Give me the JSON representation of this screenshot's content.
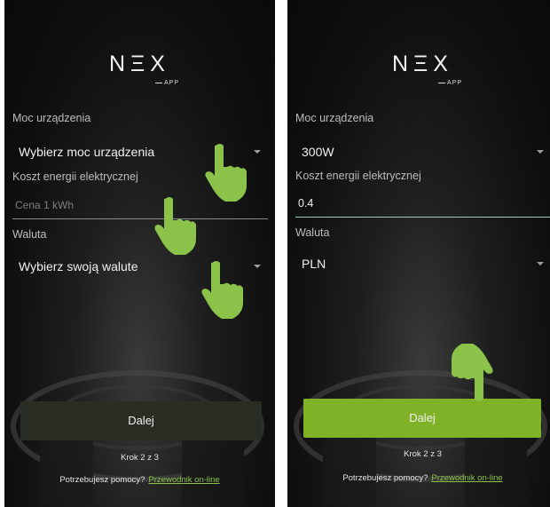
{
  "logo": {
    "main": "NΞX",
    "sub": "APP"
  },
  "left": {
    "device_power_label": "Moc urządzenia",
    "device_power_value": "Wybierz moc urządzenia",
    "energy_cost_label": "Koszt energii elektrycznej",
    "energy_cost_placeholder": "Cena 1 kWh",
    "currency_label": "Waluta",
    "currency_value": "Wybierz swoją walute",
    "next_button": "Dalej",
    "step": "Krok 2 z 3",
    "help_text": "Potrzebujesz pomocy?",
    "help_link": "Przewodnik on-line"
  },
  "right": {
    "device_power_label": "Moc urządzenia",
    "device_power_value": "300W",
    "energy_cost_label": "Koszt energii elektrycznej",
    "energy_cost_value": "0.4",
    "currency_label": "Waluta",
    "currency_value": "PLN",
    "next_button": "Dalej",
    "step": "Krok 2 z 3",
    "help_text": "Potrzebujesz pomocy?",
    "help_link": "Przewodnik on-line"
  },
  "colors": {
    "accent": "#7fb226",
    "hand": "#8bc34a",
    "active_underline": "#9acdc9"
  },
  "icons": [
    "dropdown-caret-icon",
    "pointing-hand-icon"
  ]
}
